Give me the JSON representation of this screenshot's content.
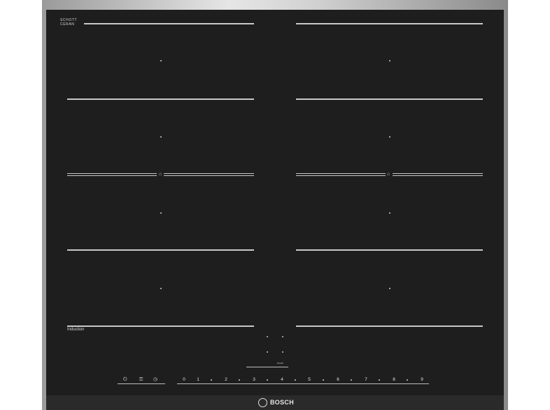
{
  "brand": {
    "lines": "SCHOTT\nCERAN",
    "sublabel": "BOSCH"
  },
  "cooktop": {
    "induction_label": "Induction",
    "bridge_icon": "⌂"
  },
  "controls": {
    "icons": [
      "power-icon",
      "child-lock-icon",
      "timer-icon"
    ],
    "power_glyph": "⏻",
    "lock_glyph": "⚿",
    "timer_glyph": "◷",
    "scale": [
      "0",
      "1",
      "2",
      "3",
      "4",
      "5",
      "6",
      "7",
      "8",
      "9"
    ],
    "mini_panel_text": "boost"
  },
  "logo": {
    "text": "BOSCH"
  }
}
